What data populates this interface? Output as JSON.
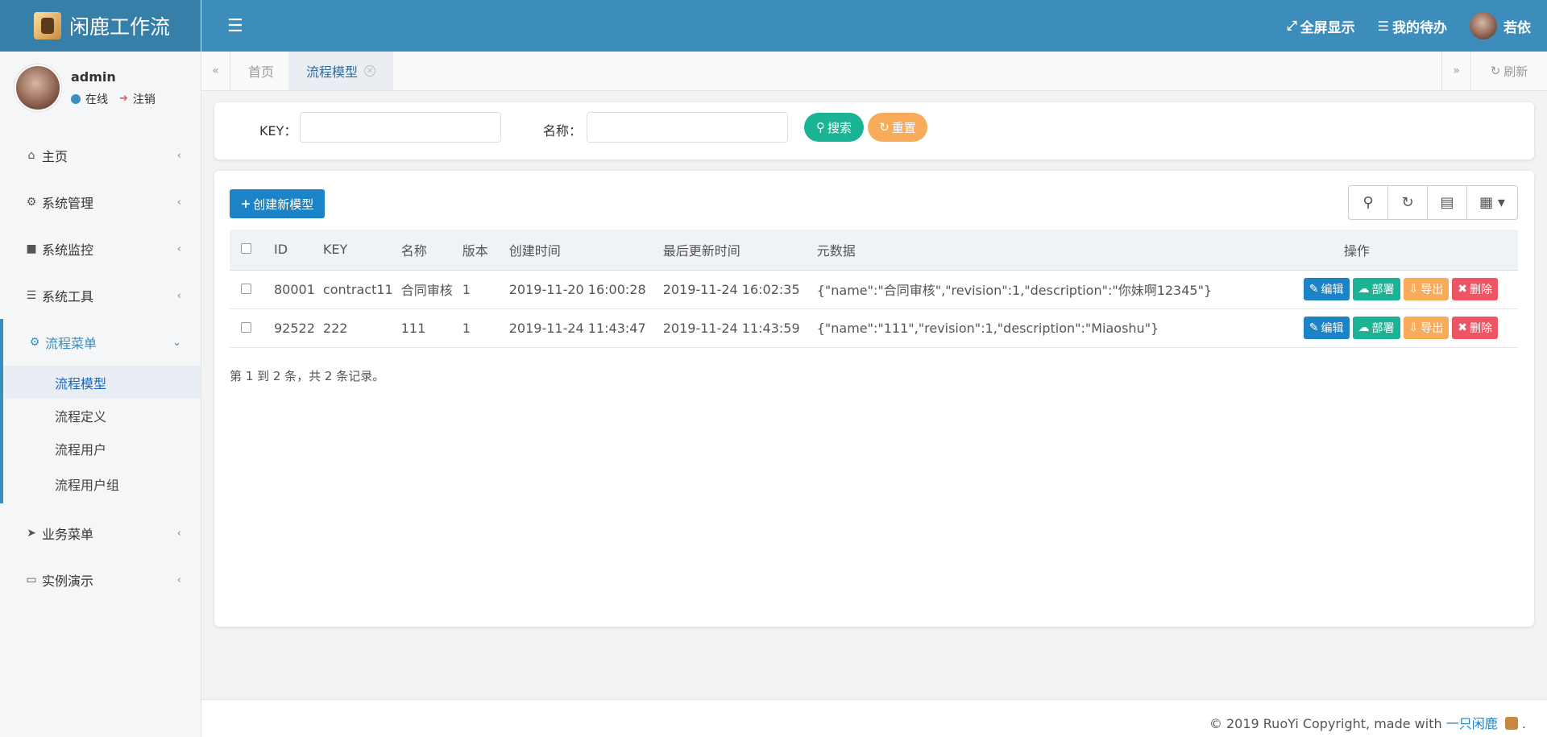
{
  "brand": {
    "title": "闲鹿工作流"
  },
  "user": {
    "name": "admin",
    "status": "在线",
    "logout": "注销"
  },
  "nav": {
    "home": "主页",
    "system": "系统管理",
    "monitor": "系统监控",
    "tools": "系统工具",
    "flow": "流程菜单",
    "flow_sub": [
      "流程模型",
      "流程定义",
      "流程用户",
      "流程用户组"
    ],
    "business": "业务菜单",
    "demo": "实例演示"
  },
  "header": {
    "fullscreen": "全屏显示",
    "todo": "我的待办",
    "username": "若依"
  },
  "tabs": {
    "home": "首页",
    "active": "流程模型",
    "refresh": "刷新"
  },
  "search": {
    "key_label": "KEY：",
    "name_label": "名称：",
    "key_value": "",
    "name_value": "",
    "search_btn": "搜索",
    "reset_btn": "重置"
  },
  "table": {
    "create_btn": "创建新模型",
    "columns": [
      "ID",
      "KEY",
      "名称",
      "版本",
      "创建时间",
      "最后更新时间",
      "元数据",
      "操作"
    ],
    "rows": [
      [
        "80001",
        "contract11",
        "合同审核",
        "1",
        "2019-11-20 16:00:28",
        "2019-11-24 16:02:35",
        "{\"name\":\"合同审核\",\"revision\":1,\"description\":\"你妹啊12345\"}"
      ],
      [
        "92522",
        "222",
        "111",
        "1",
        "2019-11-24 11:43:47",
        "2019-11-24 11:43:59",
        "{\"name\":\"111\",\"revision\":1,\"description\":\"Miaoshu\"}"
      ]
    ],
    "actions": {
      "edit": "编辑",
      "deploy": "部署",
      "export": "导出",
      "delete": "删除"
    },
    "pager": "第 1 到 2 条，共 2 条记录。"
  },
  "footer": {
    "text": "© 2019 RuoYi Copyright, made with ",
    "link": "一只闲鹿",
    "suffix": "."
  }
}
